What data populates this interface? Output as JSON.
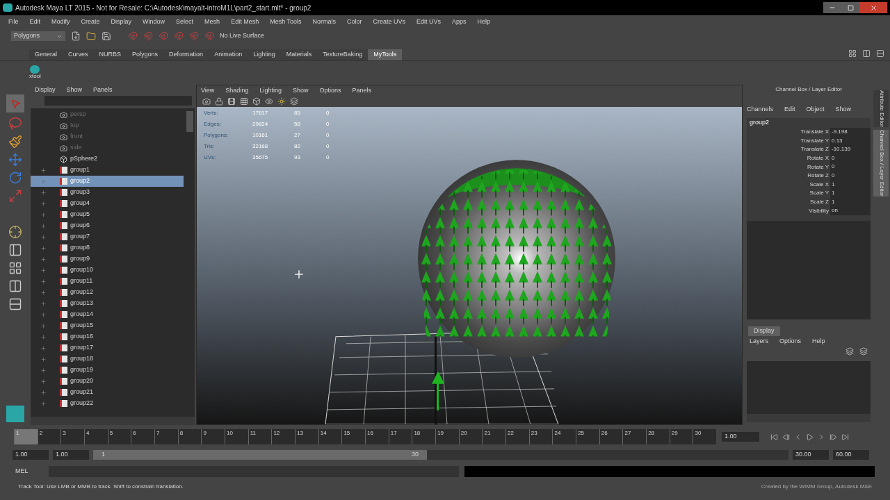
{
  "window": {
    "title": "Autodesk Maya LT 2015 - Not for Resale: C:\\Autodesk\\mayalt-introM1L\\part2_start.mlt* - group2"
  },
  "menus": [
    "File",
    "Edit",
    "Modify",
    "Create",
    "Display",
    "Window",
    "Select",
    "Mesh",
    "Edit Mesh",
    "Mesh Tools",
    "Normals",
    "Color",
    "Create UVs",
    "Edit UVs",
    "Apps",
    "Help"
  ],
  "status_line": {
    "mode": "Polygons",
    "live_surface": "No Live Surface"
  },
  "shelf": {
    "tabs": [
      {
        "label": "General",
        "selected": false
      },
      {
        "label": "Curves",
        "selected": false
      },
      {
        "label": "NURBS",
        "selected": false
      },
      {
        "label": "Polygons",
        "selected": false
      },
      {
        "label": "Deformation",
        "selected": false
      },
      {
        "label": "Animation",
        "selected": false
      },
      {
        "label": "Lighting",
        "selected": false
      },
      {
        "label": "Materials",
        "selected": false
      },
      {
        "label": "TextureBaking",
        "selected": false
      },
      {
        "label": "MyTools",
        "selected": true
      }
    ],
    "tools": [
      {
        "label": "xtool"
      }
    ]
  },
  "outliner": {
    "menus": [
      "Display",
      "Show",
      "Panels"
    ],
    "items": [
      {
        "label": "persp",
        "kind": "camera",
        "selected": false
      },
      {
        "label": "top",
        "kind": "camera",
        "selected": false
      },
      {
        "label": "front",
        "kind": "camera",
        "selected": false
      },
      {
        "label": "side",
        "kind": "camera",
        "selected": false
      },
      {
        "label": "pSphere2",
        "kind": "mesh",
        "selected": false
      },
      {
        "label": "group1",
        "kind": "group",
        "selected": false
      },
      {
        "label": "group2",
        "kind": "group",
        "selected": true
      },
      {
        "label": "group3",
        "kind": "group",
        "selected": false
      },
      {
        "label": "group4",
        "kind": "group",
        "selected": false
      },
      {
        "label": "group5",
        "kind": "group",
        "selected": false
      },
      {
        "label": "group6",
        "kind": "group",
        "selected": false
      },
      {
        "label": "group7",
        "kind": "group",
        "selected": false
      },
      {
        "label": "group8",
        "kind": "group",
        "selected": false
      },
      {
        "label": "group9",
        "kind": "group",
        "selected": false
      },
      {
        "label": "group10",
        "kind": "group",
        "selected": false
      },
      {
        "label": "group11",
        "kind": "group",
        "selected": false
      },
      {
        "label": "group12",
        "kind": "group",
        "selected": false
      },
      {
        "label": "group13",
        "kind": "group",
        "selected": false
      },
      {
        "label": "group14",
        "kind": "group",
        "selected": false
      },
      {
        "label": "group15",
        "kind": "group",
        "selected": false
      },
      {
        "label": "group16",
        "kind": "group",
        "selected": false
      },
      {
        "label": "group17",
        "kind": "group",
        "selected": false
      },
      {
        "label": "group18",
        "kind": "group",
        "selected": false
      },
      {
        "label": "group19",
        "kind": "group",
        "selected": false
      },
      {
        "label": "group20",
        "kind": "group",
        "selected": false
      },
      {
        "label": "group21",
        "kind": "group",
        "selected": false
      },
      {
        "label": "group22",
        "kind": "group",
        "selected": false
      }
    ]
  },
  "viewport": {
    "menus": [
      "View",
      "Shading",
      "Lighting",
      "Show",
      "Options",
      "Panels"
    ],
    "hud": [
      {
        "label": "Verts:",
        "values": [
          "17617",
          "85",
          "0"
        ]
      },
      {
        "label": "Edges:",
        "values": [
          "29824",
          "58",
          "0"
        ]
      },
      {
        "label": "Polygons:",
        "values": [
          "10161",
          "27",
          "0"
        ]
      },
      {
        "label": "Tris:",
        "values": [
          "32168",
          "82",
          "0"
        ]
      },
      {
        "label": "UVs:",
        "values": [
          "35675",
          "93",
          "0"
        ]
      }
    ]
  },
  "channel_box": {
    "title": "Channel Box / Layer Editor",
    "menus": [
      "Channels",
      "Edit",
      "Object",
      "Show"
    ],
    "object": "group2",
    "channels": [
      {
        "name": "Translate X",
        "value": "-9.198"
      },
      {
        "name": "Translate Y",
        "value": "0.13"
      },
      {
        "name": "Translate Z",
        "value": "-10.139"
      },
      {
        "name": "Rotate X",
        "value": "0"
      },
      {
        "name": "Rotate Y",
        "value": "0"
      },
      {
        "name": "Rotate Z",
        "value": "0"
      },
      {
        "name": "Scale X",
        "value": "1"
      },
      {
        "name": "Scale Y",
        "value": "1"
      },
      {
        "name": "Scale Z",
        "value": "1"
      },
      {
        "name": "Visibility",
        "value": "on"
      }
    ]
  },
  "layer_editor": {
    "tabs": [
      {
        "label": "Display",
        "selected": true
      }
    ],
    "menus": [
      "Layers",
      "Options",
      "Help"
    ]
  },
  "side_tabs": [
    {
      "label": "Attribute Editor",
      "selected": false
    },
    {
      "label": "Channel Box / Layer Editor",
      "selected": true
    }
  ],
  "timeline": {
    "ticks": [
      {
        "label": "1",
        "current": true
      },
      {
        "label": "2",
        "current": false
      },
      {
        "label": "3",
        "current": false
      },
      {
        "label": "4",
        "current": false
      },
      {
        "label": "5",
        "current": false
      },
      {
        "label": "6",
        "current": false
      },
      {
        "label": "7",
        "current": false
      },
      {
        "label": "8",
        "current": false
      },
      {
        "label": "9",
        "current": false
      },
      {
        "label": "10",
        "current": false
      },
      {
        "label": "11",
        "current": false
      },
      {
        "label": "12",
        "current": false
      },
      {
        "label": "13",
        "current": false
      },
      {
        "label": "14",
        "current": false
      },
      {
        "label": "15",
        "current": false
      },
      {
        "label": "16",
        "current": false
      },
      {
        "label": "17",
        "current": false
      },
      {
        "label": "18",
        "current": false
      },
      {
        "label": "19",
        "current": false
      },
      {
        "label": "20",
        "current": false
      },
      {
        "label": "21",
        "current": false
      },
      {
        "label": "22",
        "current": false
      },
      {
        "label": "23",
        "current": false
      },
      {
        "label": "24",
        "current": false
      },
      {
        "label": "25",
        "current": false
      },
      {
        "label": "26",
        "current": false
      },
      {
        "label": "27",
        "current": false
      },
      {
        "label": "28",
        "current": false
      },
      {
        "label": "29",
        "current": false
      },
      {
        "label": "30",
        "current": false
      }
    ],
    "current_frame": "1.00"
  },
  "range": {
    "start": "1.00",
    "playback_start": "1.00",
    "slider_start": "1",
    "slider_end": "30",
    "level": 0.48,
    "playback_end": "30.00",
    "end": "60.00"
  },
  "command_line": {
    "label": "MEL"
  },
  "help_line": {
    "text": "Track Tool: Use LMB or MMB to track. Shift to constrain translation.",
    "credit": "Created by the WIMM Group, Autodesk M&E"
  }
}
